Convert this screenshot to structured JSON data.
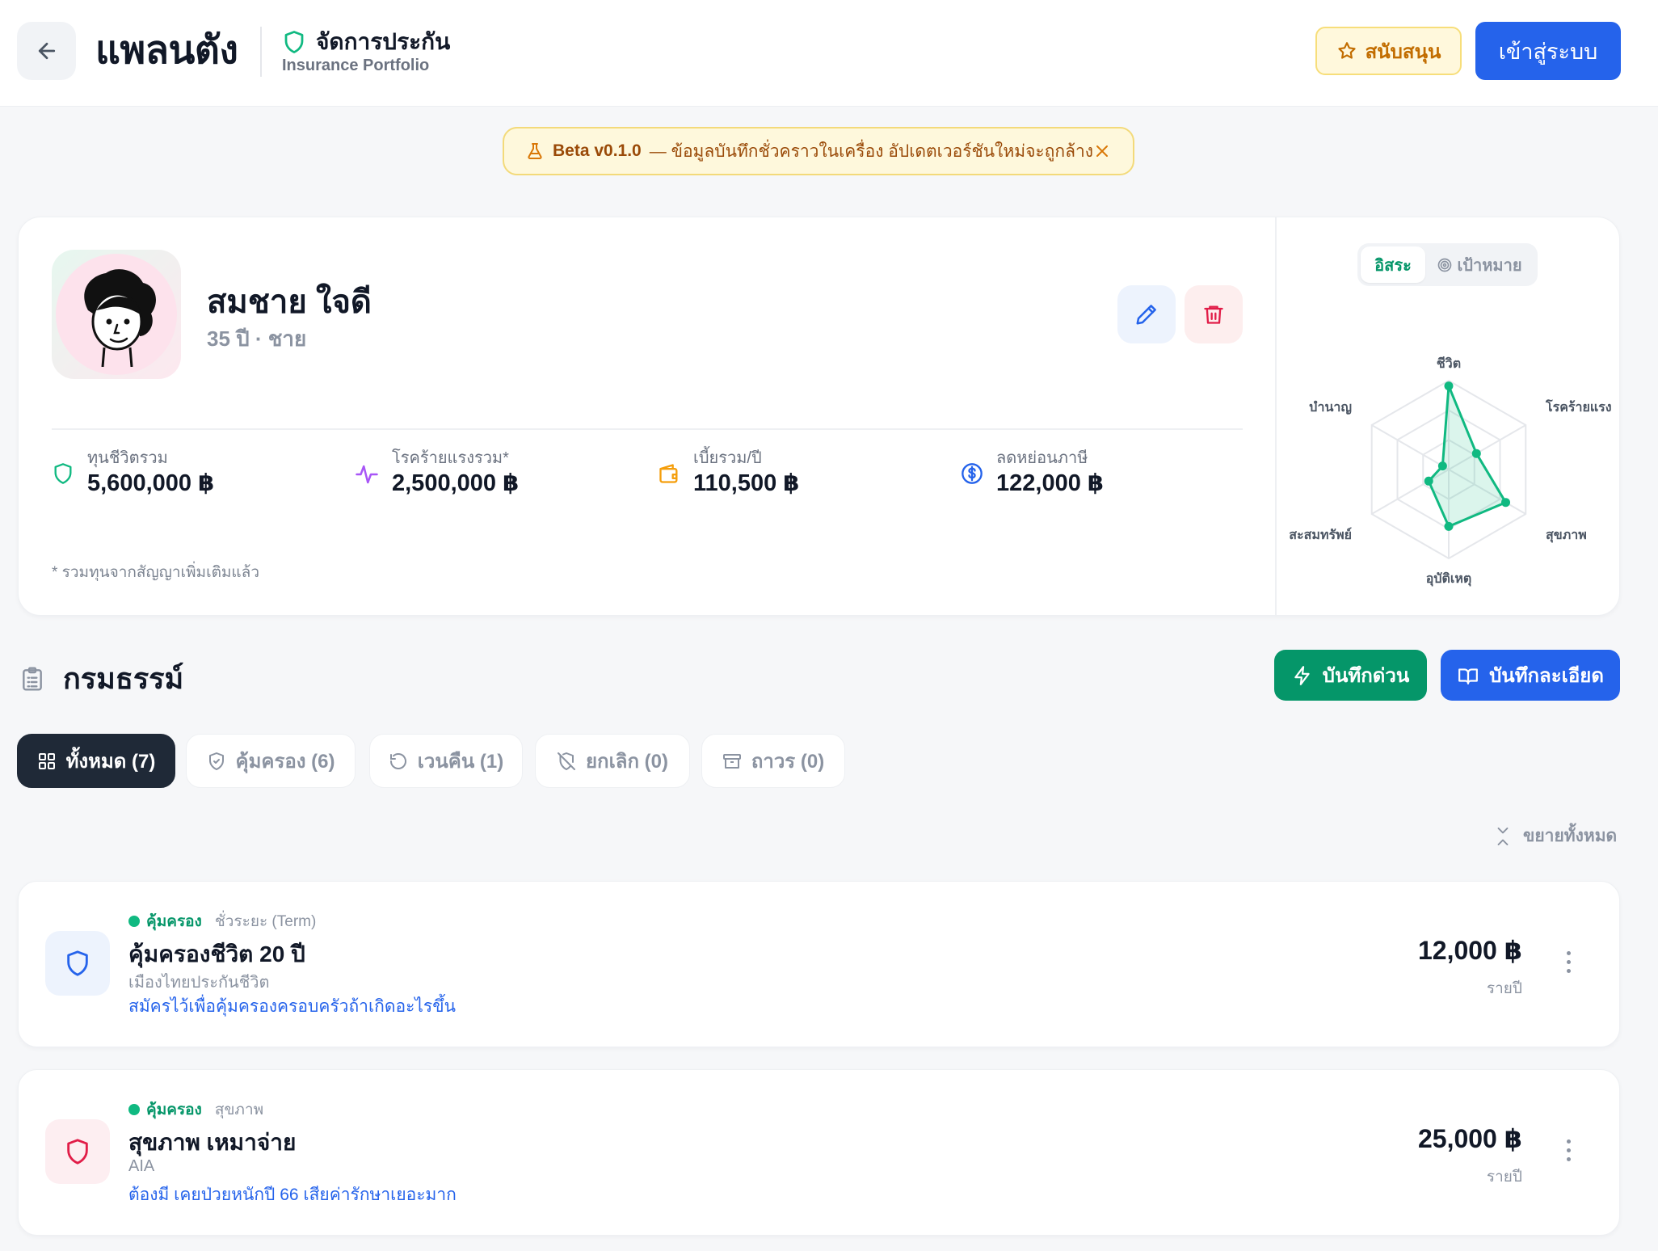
{
  "header": {
    "brand": "แพลนตัง",
    "portfolio_title": "จัดการประกัน",
    "portfolio_subtitle": "Insurance Portfolio",
    "support_label": "สนับสนุน",
    "login_label": "เข้าสู่ระบบ"
  },
  "banner": {
    "version": "Beta v0.1.0",
    "message": "— ข้อมูลบันทึกชั่วคราวในเครื่อง อัปเดตเวอร์ชันใหม่จะถูกล้าง"
  },
  "profile": {
    "name": "สมชาย ใจดี",
    "meta": "35 ปี · ชาย",
    "stats": [
      {
        "label": "ทุนชีวิตรวม",
        "value": "5,600,000 ฿",
        "icon": "shield-icon",
        "color": "#10b981"
      },
      {
        "label": "โรคร้ายแรงรวม*",
        "value": "2,500,000 ฿",
        "icon": "pulse-icon",
        "color": "#a855f7"
      },
      {
        "label": "เบี้ยรวม/ปี",
        "value": "110,500 ฿",
        "icon": "wallet-icon",
        "color": "#f59e0b"
      },
      {
        "label": "ลดหย่อนภาษี",
        "value": "122,000 ฿",
        "icon": "dollar-circle-icon",
        "color": "#2563eb"
      }
    ],
    "footnote": "* รวมทุนจากสัญญาเพิ่มเติมแล้ว"
  },
  "radar": {
    "mode_free": "อิสระ",
    "mode_goal": "เป้าหมาย",
    "accent": "#10b981",
    "axes": [
      "ชีวิต",
      "โรคร้ายแรง",
      "สุขภาพ",
      "อุบัติเหตุ",
      "สะสมทรัพย์",
      "บำนาญ"
    ],
    "values": [
      0.94,
      0.36,
      0.74,
      0.64,
      0.26,
      0.08
    ]
  },
  "policies": {
    "section_title": "กรมธรรม์",
    "quick_label": "บันทึกด่วน",
    "detail_label": "บันทึกละเอียด",
    "tabs": [
      {
        "label": "ทั้งหมด (7)",
        "icon": "grid-icon"
      },
      {
        "label": "คุ้มครอง (6)",
        "icon": "shield-check-icon"
      },
      {
        "label": "เวนคืน (1)",
        "icon": "rotate-icon"
      },
      {
        "label": "ยกเลิก (0)",
        "icon": "shield-off-icon"
      },
      {
        "label": "ถาวร (0)",
        "icon": "archive-icon"
      }
    ],
    "expand_all": "ขยายทั้งหมด",
    "items": [
      {
        "status": "คุ้มครอง",
        "type": "ชั่วระยะ (Term)",
        "name": "คุ้มครองชีวิต 20 ปี",
        "company": "เมืองไทยประกันชีวิต",
        "note": "สมัครไว้เพื่อคุ้มครองครอบครัวถ้าเกิดอะไรขึ้น",
        "premium": "12,000 ฿",
        "unit": "รายปี",
        "color": "#2563eb"
      },
      {
        "status": "คุ้มครอง",
        "type": "สุขภาพ",
        "name": "สุขภาพ เหมาจ่าย",
        "company": "AIA",
        "note": "ต้องมี เคยป่วยหนักปี 66 เสียค่ารักษาเยอะมาก",
        "premium": "25,000 ฿",
        "unit": "รายปี",
        "color": "#e11d48"
      }
    ]
  }
}
